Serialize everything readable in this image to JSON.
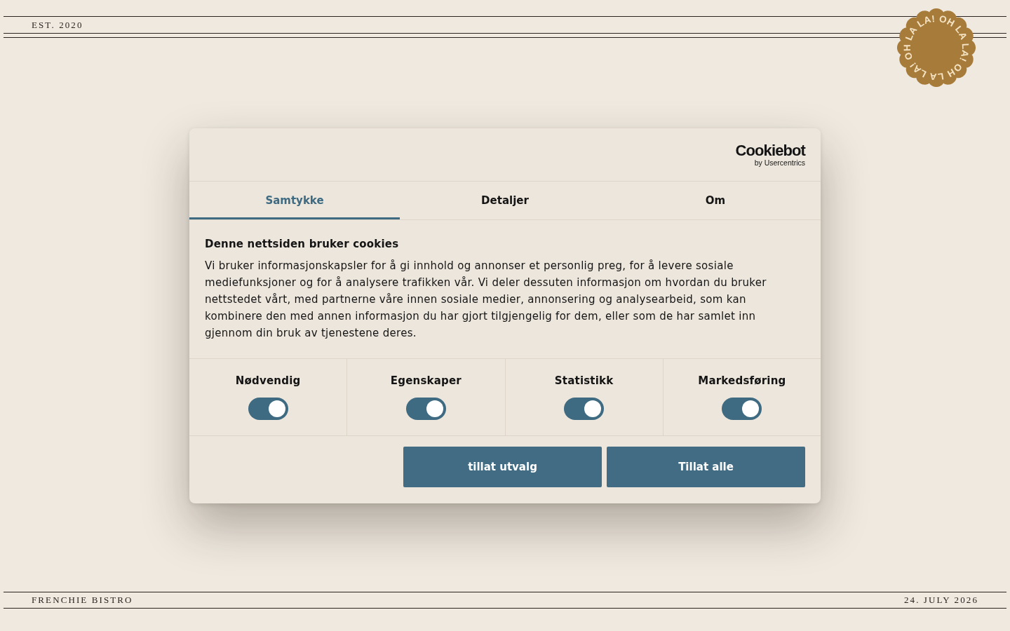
{
  "header": {
    "established": "EST. 2020"
  },
  "badge": {
    "texts": [
      "OH LA LA!",
      "OH LA LA!",
      "OH LA LA!"
    ]
  },
  "dialog": {
    "logo": {
      "wordmark": "Cookiebot",
      "byline": "by Usercentrics"
    },
    "tabs": [
      {
        "label": "Samtykke",
        "selected": true
      },
      {
        "label": "Detaljer",
        "selected": false
      },
      {
        "label": "Om",
        "selected": false
      }
    ],
    "title": "Denne nettsiden bruker cookies",
    "body": "Vi bruker informasjonskapsler for å gi innhold og annonser et personlig preg, for å levere sosiale mediefunksjoner og for å analysere trafikken vår. Vi deler dessuten informasjon om hvordan du bruker nettstedet vårt, med partnerne våre innen sosiale medier, annonsering og analysearbeid, som kan kombinere den med annen informasjon du har gjort tilgjengelig for dem, eller som de har samlet inn gjennom din bruk av tjenestene deres.",
    "categories": [
      {
        "label": "Nødvendig",
        "checked": true
      },
      {
        "label": "Egenskaper",
        "checked": true
      },
      {
        "label": "Statistikk",
        "checked": true
      },
      {
        "label": "Markedsføring",
        "checked": true
      }
    ],
    "buttons": [
      "tillat utvalg",
      "Tillat alle"
    ]
  },
  "footer": {
    "name": "FRENCHIE BISTRO",
    "date": "24. JULY 2026"
  }
}
